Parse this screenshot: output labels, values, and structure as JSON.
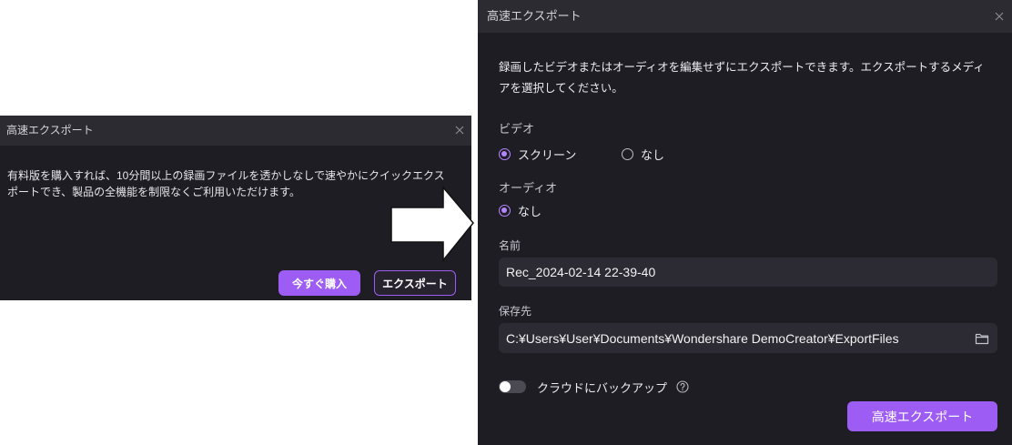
{
  "theme": {
    "accent": "#9d5cf3",
    "accent_light": "#b585ff",
    "dialog_bg": "#1e1d24",
    "titlebar_bg": "#2c2b32",
    "input_bg": "#2c2b33",
    "page_bg": "#ffffff"
  },
  "left_dialog": {
    "title": "高速エクスポート",
    "close_icon": "close-icon",
    "message": "有料版を購入すれば、10分間以上の録画ファイルを透かしなしで速やかにクイックエクスポートでき、製品の全機能を制限なくご利用いただけます。",
    "buy_button_label": "今すぐ購入",
    "export_button_label": "エクスポート"
  },
  "transition_arrow_icon": "arrow-right-icon",
  "right_dialog": {
    "title": "高速エクスポート",
    "close_icon": "close-icon",
    "description": "録画したビデオまたはオーディオを編集せずにエクスポートできます。エクスポートするメディアを選択してください。",
    "video": {
      "label": "ビデオ",
      "options": [
        {
          "label": "スクリーン",
          "selected": true
        },
        {
          "label": "なし",
          "selected": false
        }
      ]
    },
    "audio": {
      "label": "オーディオ",
      "options": [
        {
          "label": "なし",
          "selected": true
        }
      ]
    },
    "name": {
      "label": "名前",
      "value": "Rec_2024-02-14 22-39-40"
    },
    "save_location": {
      "label": "保存先",
      "value": "C:¥Users¥User¥Documents¥Wondershare DemoCreator¥ExportFiles",
      "icon": "folder-icon"
    },
    "cloud_backup": {
      "label": "クラウドにバックアップ",
      "enabled": false,
      "help_icon": "help-icon"
    },
    "export_button_label": "高速エクスポート"
  }
}
